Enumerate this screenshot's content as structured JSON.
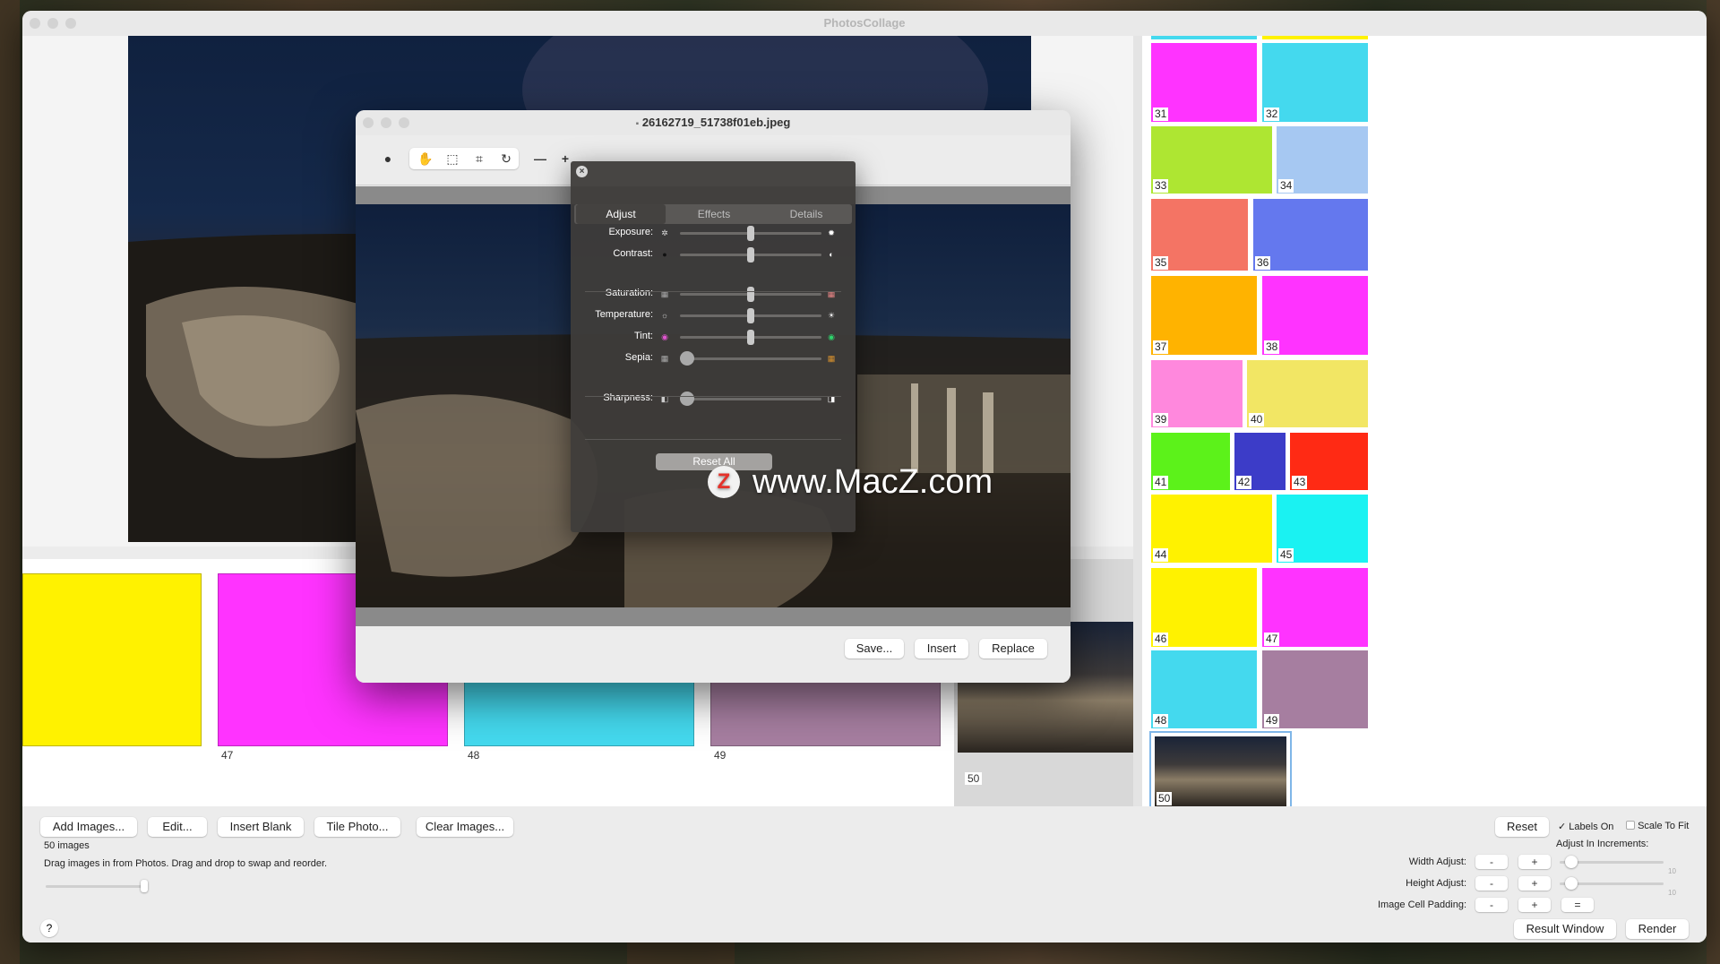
{
  "app": {
    "title": "PhotosCollage"
  },
  "editor": {
    "title": "26162719_51738f01eb.jpeg",
    "footer": {
      "save_label": "Save...",
      "insert_label": "Insert",
      "replace_label": "Replace"
    }
  },
  "hud": {
    "tabs": [
      {
        "label": "Adjust",
        "active": true
      },
      {
        "label": "Effects",
        "active": false
      },
      {
        "label": "Details",
        "active": false
      }
    ],
    "sliders": [
      {
        "label": "Exposure:",
        "value": 0.5,
        "icon": "sun-small-icon",
        "hi_icon": "sun-large-icon"
      },
      {
        "label": "Contrast:",
        "value": 0.5,
        "icon": "contrast-dark-icon",
        "hi_icon": "contrast-half-icon"
      },
      {
        "label": "Saturation:",
        "value": 0.5,
        "icon": "saturation-low-icon",
        "hi_icon": "saturation-high-icon"
      },
      {
        "label": "Temperature:",
        "value": 0.5,
        "icon": "temperature-cool-icon",
        "hi_icon": "temperature-warm-icon"
      },
      {
        "label": "Tint:",
        "value": 0.5,
        "icon": "tint-magenta-icon",
        "hi_icon": "tint-green-icon"
      },
      {
        "label": "Sepia:",
        "value": 0.0,
        "icon": "sepia-low-icon",
        "hi_icon": "sepia-high-icon"
      },
      {
        "label": "Sharpness:",
        "value": 0.0,
        "icon": "sharpness-low-icon",
        "hi_icon": "sharpness-high-icon"
      }
    ],
    "reset_label": "Reset All"
  },
  "watermark": {
    "logo": "Z",
    "text": "www.MacZ.com"
  },
  "strip": {
    "tiles": [
      {
        "color": "#fff200",
        "label": ""
      },
      {
        "color": "#ff33ff",
        "label": "47"
      },
      {
        "color": "#44d9ee",
        "label": "48"
      },
      {
        "color": "#a67ea0",
        "label": "49"
      }
    ],
    "selected_label": "50"
  },
  "grid": {
    "tiles": [
      {
        "n": "31",
        "color": "#ff33ff"
      },
      {
        "n": "32",
        "color": "#44d9ee"
      },
      {
        "n": "33",
        "color": "#aee632"
      },
      {
        "n": "34",
        "color": "#a6c8f2"
      },
      {
        "n": "35",
        "color": "#f47464"
      },
      {
        "n": "36",
        "color": "#6478ee"
      },
      {
        "n": "37",
        "color": "#ffb300"
      },
      {
        "n": "38",
        "color": "#ff33ff"
      },
      {
        "n": "39",
        "color": "#ff88dd"
      },
      {
        "n": "40",
        "color": "#f2e664"
      },
      {
        "n": "41",
        "color": "#5cf21a"
      },
      {
        "n": "42",
        "color": "#3c3cc8"
      },
      {
        "n": "43",
        "color": "#ff2a14"
      },
      {
        "n": "44",
        "color": "#fff200"
      },
      {
        "n": "45",
        "color": "#1af2f2"
      },
      {
        "n": "46",
        "color": "#fff200"
      },
      {
        "n": "47",
        "color": "#ff33ff"
      },
      {
        "n": "48",
        "color": "#44d9ee"
      },
      {
        "n": "49",
        "color": "#a67ea0"
      },
      {
        "n": "50",
        "color": "photo"
      }
    ]
  },
  "bottom": {
    "add_images": "Add Images...",
    "edit": "Edit...",
    "insert_blank": "Insert Blank",
    "tile_photo": "Tile Photo...",
    "clear_images": "Clear Images...",
    "count": "50 images",
    "hint": "Drag images in from Photos. Drag and drop to swap and reorder.",
    "help": "?",
    "reset": "Reset",
    "labels_on": "Labels On",
    "scale_to_fit": "Scale To Fit",
    "adjust_increments": "Adjust In Increments:",
    "width_adjust": "Width Adjust:",
    "height_adjust": "Height Adjust:",
    "cell_padding": "Image Cell Padding:",
    "minus": "-",
    "plus": "+",
    "equals": "=",
    "increment_max": "10",
    "result_window": "Result Window",
    "render": "Render"
  }
}
